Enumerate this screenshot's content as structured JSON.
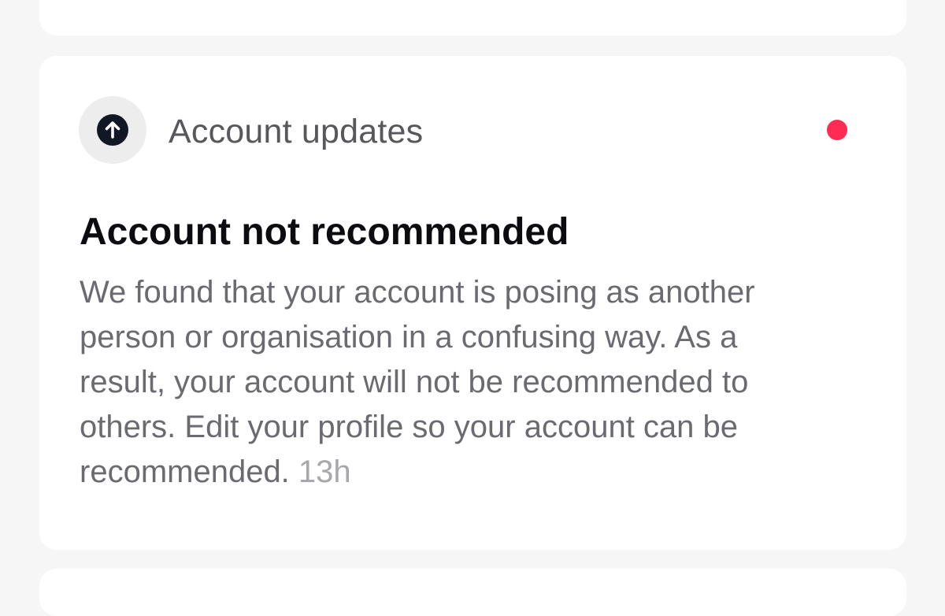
{
  "notification": {
    "category": "Account updates",
    "category_icon": "arrow-up-circle-icon",
    "unread": true,
    "unread_color": "#fe2c55",
    "title": "Account not recommended",
    "body_lines": [
      "We found that your account is posing as another",
      "person or organisation in a confusing way. As a",
      "result, your account will not be recommended to",
      "others. Edit your profile so your account can be",
      "recommended."
    ],
    "timestamp": "13h"
  }
}
